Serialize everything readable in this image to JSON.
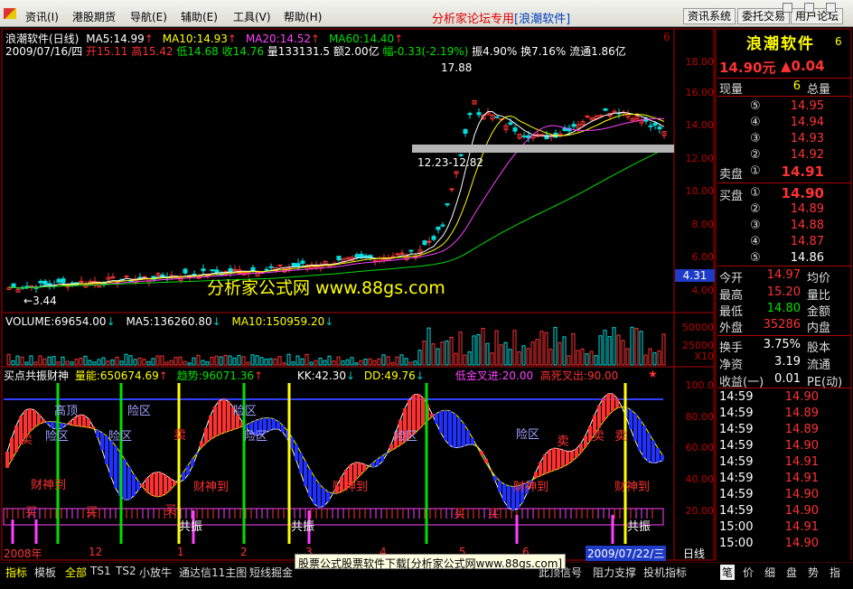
{
  "menu": {
    "items": [
      "资讯(I)",
      "港股期货",
      "导航(E)",
      "辅助(E)",
      "工具(V)",
      "帮助(H)"
    ],
    "title_red": "分析家论坛专用",
    "title_blue": "[浪潮软件]",
    "buttons": [
      "资讯系统",
      "委托交易",
      "用户论坛"
    ]
  },
  "chart_header": {
    "name": "浪潮软件(日线)",
    "ma5": "MA5:14.99",
    "ma10": "MA10:14.93",
    "ma20": "MA20:14.52",
    "ma60": "MA60:14.40",
    "date": "2009/07/16/四",
    "open": "开15.11",
    "high": "高15.42",
    "low": "低14.68",
    "close": "收14.76",
    "vol": "量133131.5",
    "amount": "额2.00亿",
    "change": "幅-0.33(-2.19%)",
    "amp": "振4.90%",
    "turn": "换7.16%",
    "float": "流通1.86亿"
  },
  "annotations": {
    "max_price": "17.88",
    "min_price": "3.44",
    "range_label": "12.23-12.82",
    "price_tag": "4.31",
    "watermark": "分析家公式网 www.88gs.com"
  },
  "price_axis": [
    "18.00",
    "16.00",
    "14.00",
    "12.00",
    "10.00",
    "8.00",
    "6.00",
    "4.00"
  ],
  "volume_axis": [
    "50000",
    "25000",
    "X10"
  ],
  "volume_header": {
    "vol": "VOLUME:69654.00",
    "ma5": "MA5:136260.80",
    "ma10": "MA10:150959.20"
  },
  "indicator_header": {
    "name": "买点共振财神",
    "energy": "量能:650674.69",
    "trend": "趋势:96071.36",
    "kk": "KK:42.30",
    "dd": "DD:49.76",
    "low_gold": "低金叉进:20.00",
    "high_dead": "高死叉出:90.00"
  },
  "indicator_axis": [
    "100.0",
    "80.00",
    "60.00",
    "40.00",
    "20.00"
  ],
  "indicator_labels": {
    "risk": [
      "险区",
      "险区",
      "险区",
      "险区",
      "险区",
      "险区",
      "险区",
      "高顶"
    ],
    "sell": [
      "卖",
      "卖",
      "卖",
      "卖",
      "卖"
    ],
    "buy": [
      "买",
      "买",
      "买",
      "买",
      "买"
    ],
    "god": [
      "财神到",
      "财神到",
      "财神到",
      "财神到",
      "财神到"
    ],
    "resonance": [
      "共振",
      "共振",
      "共振"
    ]
  },
  "date_axis": {
    "start": "2008年",
    "ticks": [
      "12",
      "1",
      "2",
      "3",
      "4",
      "5",
      "6"
    ],
    "current": "2009/07/22/三",
    "period": "日线"
  },
  "right_panel": {
    "stock_name": "浪潮软件",
    "stock_digit": "6",
    "price": "14.90元",
    "change": "▲0.04",
    "now_label": "现量",
    "now_val": "6",
    "total_label": "总量",
    "sell_label": "卖盘",
    "buy_label": "买盘",
    "sell_nums": [
      "⑤",
      "④",
      "③",
      "②",
      "①"
    ],
    "sell_prices": [
      "14.95",
      "14.94",
      "14.93",
      "14.92",
      "14.91"
    ],
    "buy_nums": [
      "①",
      "②",
      "③",
      "④",
      "⑤"
    ],
    "buy_prices": [
      "14.90",
      "14.89",
      "14.88",
      "14.87",
      "14.86"
    ],
    "stats": [
      {
        "label": "今开",
        "value": "14.97",
        "label2": "均价"
      },
      {
        "label": "最高",
        "value": "15.20",
        "label2": "量比"
      },
      {
        "label": "最低",
        "value": "14.80",
        "label2": "金额"
      },
      {
        "label": "外盘",
        "value": "35286",
        "label2": "内盘"
      }
    ],
    "stats2": [
      {
        "label": "换手",
        "value": "3.75%",
        "label2": "股本"
      },
      {
        "label": "净资",
        "value": "3.19",
        "label2": "流通"
      },
      {
        "label": "收益(一)",
        "value": "0.01",
        "label2": "PE(动)"
      }
    ],
    "ticks": [
      {
        "time": "14:59",
        "price": "14.90"
      },
      {
        "time": "14:59",
        "price": "14.89"
      },
      {
        "time": "14:59",
        "price": "14.89"
      },
      {
        "time": "14:59",
        "price": "14.90"
      },
      {
        "time": "14:59",
        "price": "14.91"
      },
      {
        "time": "14:59",
        "price": "14.91"
      },
      {
        "time": "14:59",
        "price": "14.90"
      },
      {
        "time": "14:59",
        "price": "14.90"
      },
      {
        "time": "15:00",
        "price": "14.91"
      },
      {
        "time": "15:00",
        "price": "14.90"
      }
    ]
  },
  "bottom_tabs": [
    "指标",
    "模板",
    "全部",
    "TS1",
    "TS2",
    "小放牛",
    "通达信11主图",
    "短线掘金"
  ],
  "bottom_tabs_right": [
    "此顶信号",
    "阻力支撑",
    "投机指标"
  ],
  "notice": "股票公式股票软件下载[分析家公式网www.88gs.com]",
  "right_tabs": [
    "笔",
    "价",
    "细",
    "盘",
    "势",
    "指"
  ]
}
